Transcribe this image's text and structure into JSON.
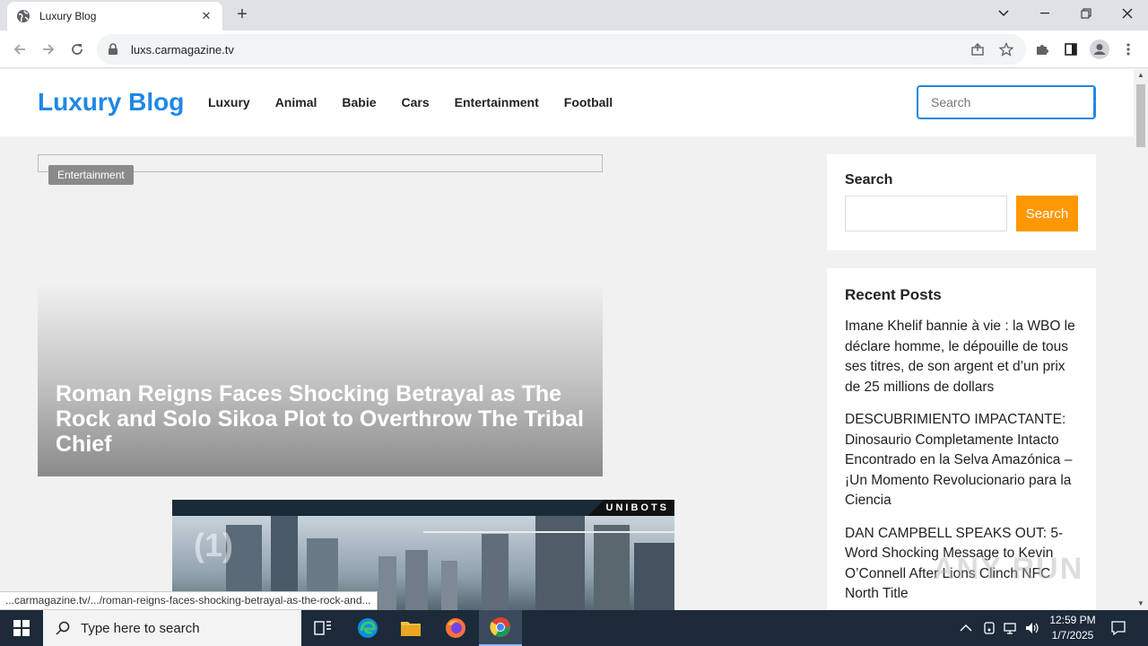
{
  "browser": {
    "tab_title": "Luxury Blog",
    "url": "luxs.carmagazine.tv",
    "status_url": "...carmagazine.tv/.../roman-reigns-faces-shocking-betrayal-as-the-rock-and..."
  },
  "site": {
    "brand": "Luxury Blog",
    "nav": [
      "Luxury",
      "Animal",
      "Babie",
      "Cars",
      "Entertainment",
      "Football"
    ],
    "header_search_placeholder": "Search",
    "brand_color": "#1e88e5"
  },
  "feature": {
    "category": "Entertainment",
    "title": "Roman Reigns Faces Shocking Betrayal as The Rock and Solo Sikoa Plot to Overthrow The Tribal Chief"
  },
  "ad": {
    "label": "UNIBOTS",
    "counter": "(1)"
  },
  "sidebar": {
    "search_title": "Search",
    "search_button": "Search",
    "search_button_color": "#ff9800",
    "recent_title": "Recent Posts",
    "recent_posts": [
      "Imane Khelif bannie à vie : la WBO le déclare homme, le dépouille de tous ses titres, de son argent et d’un prix de 25 millions de dollars",
      "DESCUBRIMIENTO IMPACTANTE: Dinosaurio Completamente Intacto Encontrado en la Selva Amazónica – ¡Un Momento Revolucionario para la Ciencia",
      "DAN CAMPBELL SPEAKS OUT: 5-Word Shocking Message to Kevin O’Connell After Lions Clinch NFC North Title"
    ]
  },
  "watermark": "ANY RUN",
  "taskbar": {
    "search_placeholder": "Type here to search",
    "time": "12:59 PM",
    "date": "1/7/2025"
  }
}
